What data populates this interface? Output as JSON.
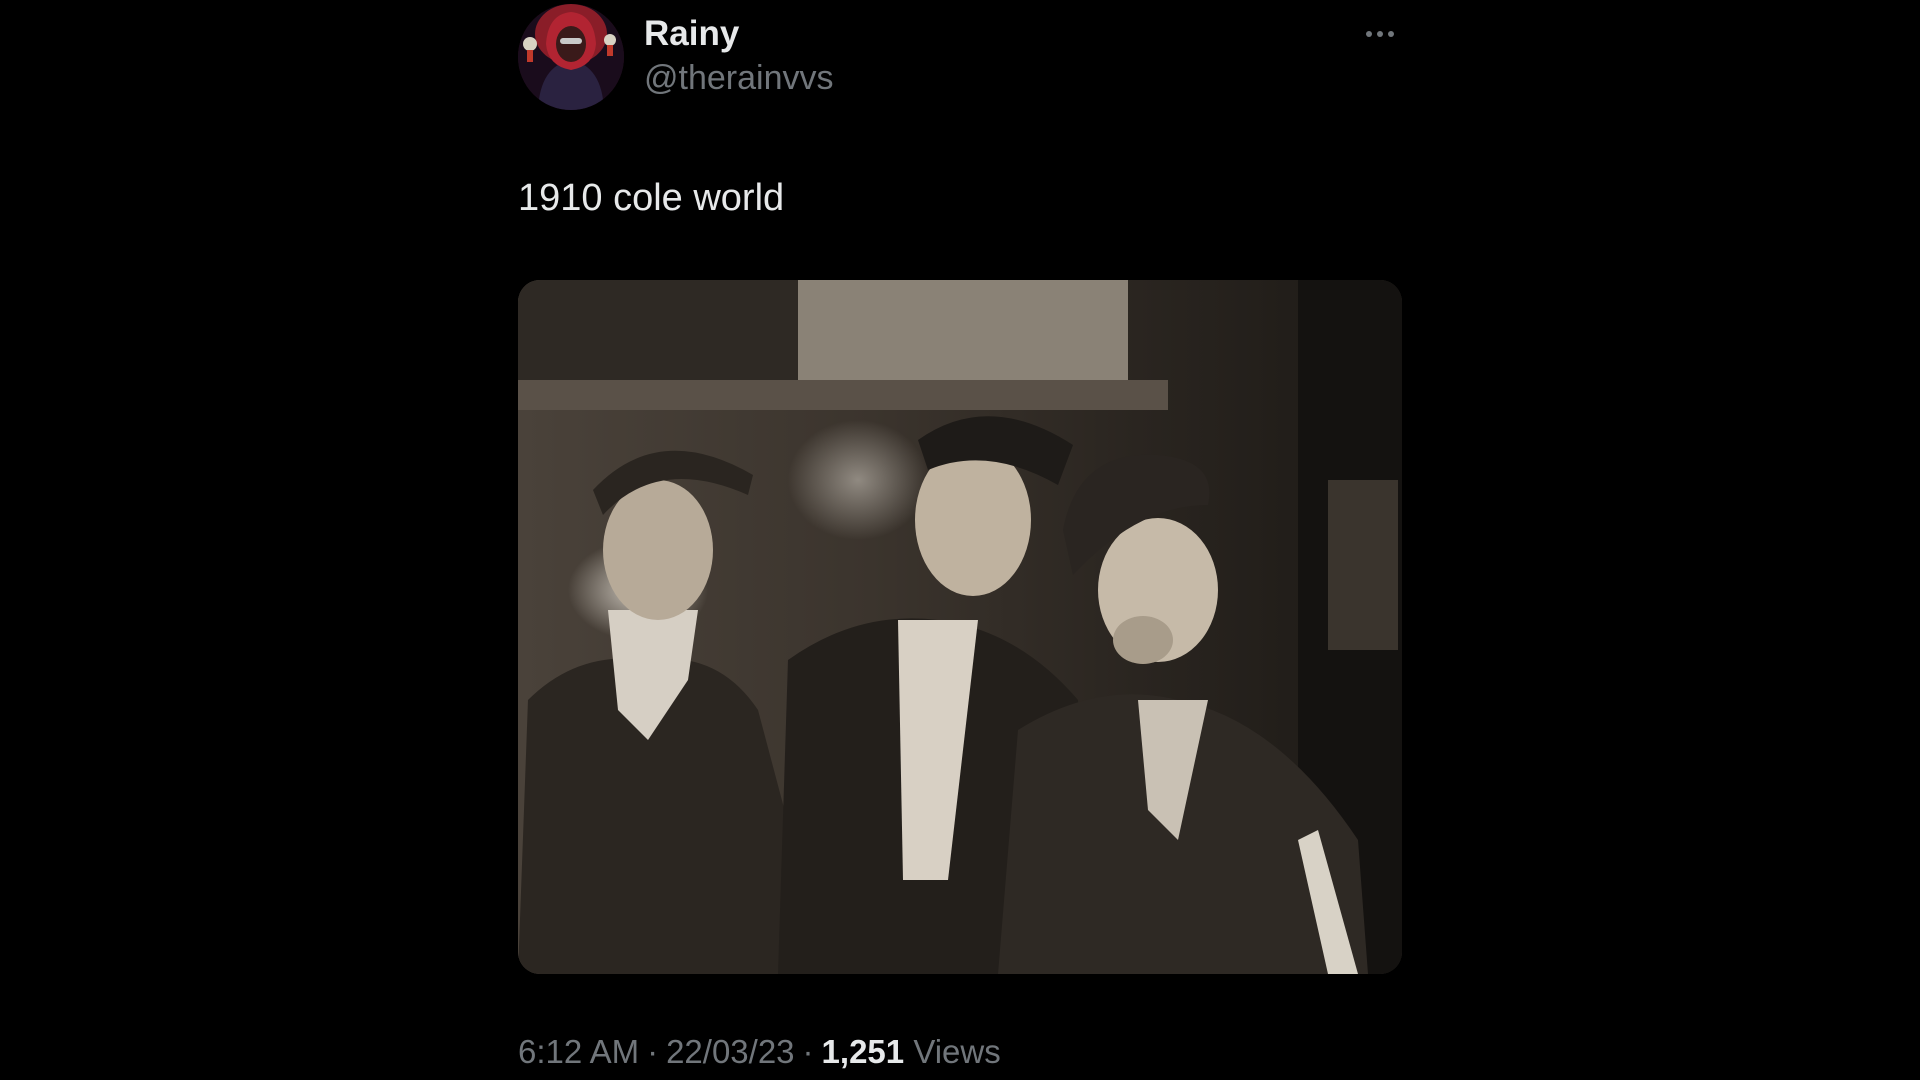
{
  "author": {
    "display_name": "Rainy",
    "handle": "@therainvvs",
    "avatar_icon": "hooded-figure-avatar"
  },
  "tweet": {
    "text": "1910 cole world",
    "media_description_icon": "vintage-photo"
  },
  "meta": {
    "time": "6:12 AM",
    "date": "22/03/23",
    "separator": "·",
    "views_count": "1,251",
    "views_label": "Views"
  },
  "colors": {
    "background": "#000000",
    "primary_text": "#e7e9ea",
    "secondary_text": "#71767b"
  }
}
